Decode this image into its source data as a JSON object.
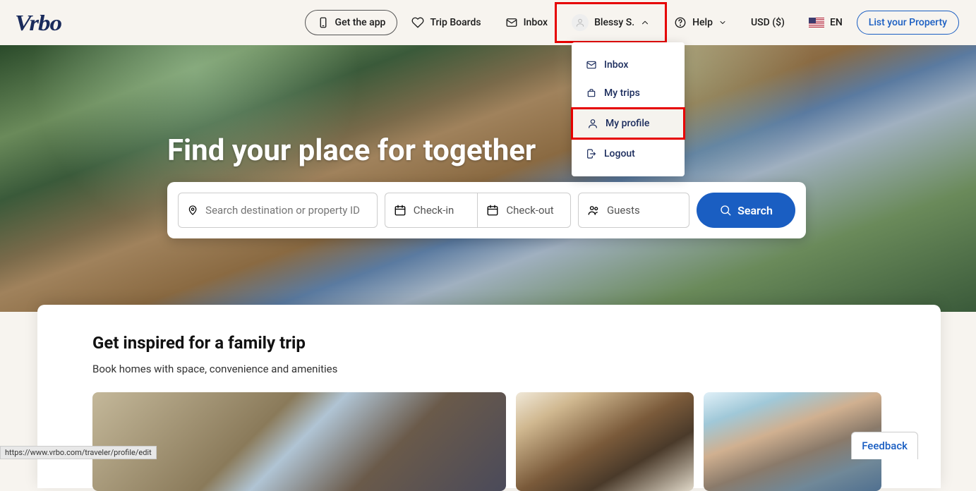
{
  "header": {
    "logo": "Vrbo",
    "get_app": "Get the app",
    "trip_boards": "Trip Boards",
    "inbox": "Inbox",
    "user_name": "Blessy S.",
    "help": "Help",
    "currency": "USD ($)",
    "language": "EN",
    "list_property": "List your Property"
  },
  "dropdown": {
    "items": [
      {
        "id": "inbox",
        "label": "Inbox",
        "icon": "mail"
      },
      {
        "id": "my-trips",
        "label": "My trips",
        "icon": "suitcase"
      },
      {
        "id": "my-profile",
        "label": "My profile",
        "icon": "user",
        "highlighted": true
      },
      {
        "id": "logout",
        "label": "Logout",
        "icon": "exit"
      }
    ]
  },
  "hero": {
    "title": "Find your place for together",
    "search": {
      "destination_placeholder": "Search destination or property ID",
      "checkin_placeholder": "Check-in",
      "checkout_placeholder": "Check-out",
      "guests_placeholder": "Guests",
      "button": "Search"
    }
  },
  "inspire": {
    "title": "Get inspired for a family trip",
    "subtitle": "Book homes with space, convenience and amenities"
  },
  "misc": {
    "feedback": "Feedback",
    "status_url": "https://www.vrbo.com/traveler/profile/edit"
  }
}
